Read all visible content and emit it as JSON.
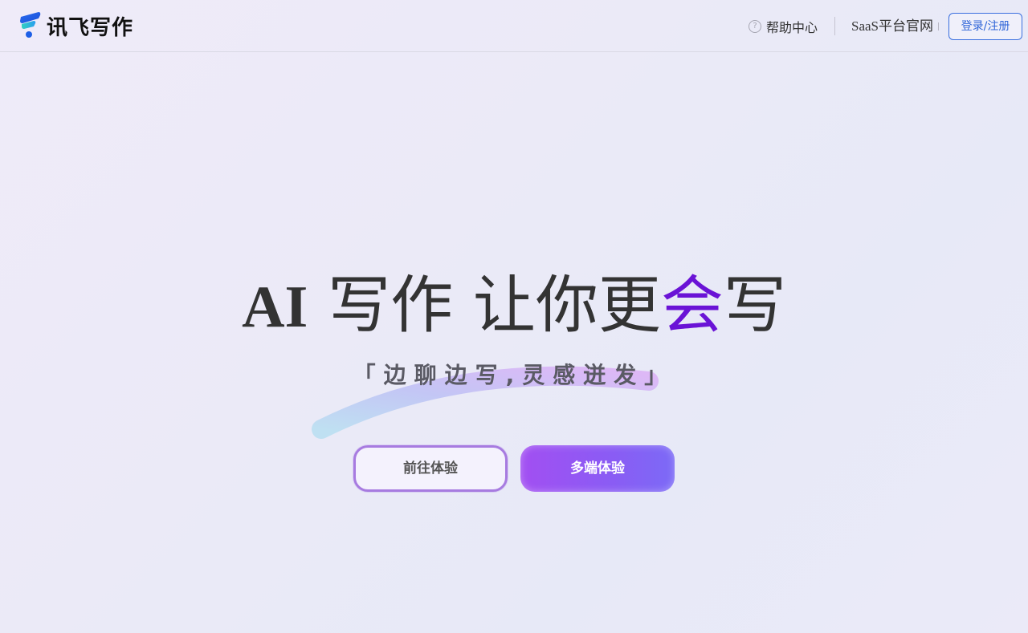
{
  "header": {
    "logo_text": "讯飞写作",
    "help_label": "帮助中心",
    "saas_label": "SaaS平台官网",
    "login_label": "登录/注册"
  },
  "hero": {
    "title_ai": "AI",
    "title_part1": "写作 让你更",
    "title_highlight": "会",
    "title_part2": "写",
    "subtitle": "「边聊边写,灵感迸发」",
    "btn_try": "前往体验",
    "btn_multi": "多端体验"
  },
  "colors": {
    "accent": "#6a13d6",
    "login_border": "#3a6fdf",
    "button_gradient_start": "#a24ff2",
    "button_gradient_end": "#7c6af6"
  }
}
